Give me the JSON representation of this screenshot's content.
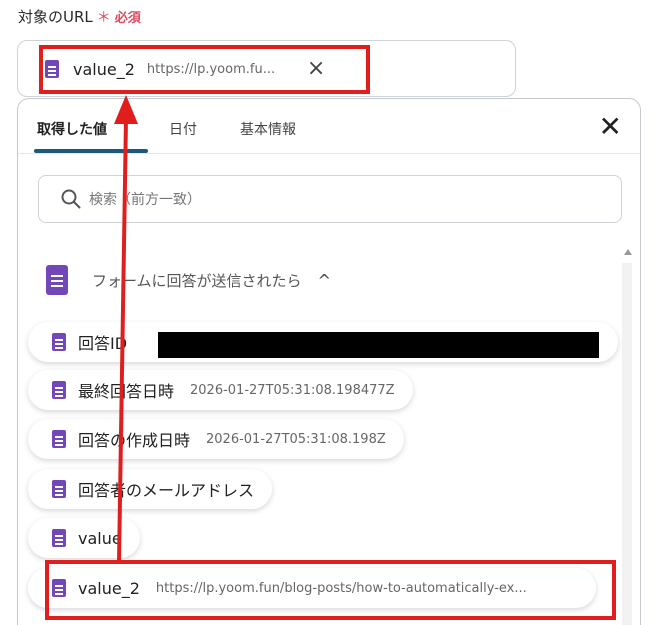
{
  "field": {
    "label": "対象のURL",
    "required_mark": "＊",
    "required_text": "必須",
    "selected": {
      "name": "value_2",
      "url": "https://lp.yoom.fu...",
      "close_icon": "×"
    }
  },
  "panel": {
    "tabs": [
      {
        "label": "取得した値"
      },
      {
        "label": "日付"
      },
      {
        "label": "基本情報"
      }
    ],
    "close_icon": "✕",
    "search_placeholder": "検索（前方一致）",
    "section": {
      "title": "フォームに回答が送信されたら",
      "chevron": "^"
    },
    "items": [
      {
        "label": "回答ID",
        "value": ""
      },
      {
        "label": "最終回答日時",
        "value": "2026-01-27T05:31:08.198477Z"
      },
      {
        "label": "回答の作成日時",
        "value": "2026-01-27T05:31:08.198Z"
      },
      {
        "label": "回答者のメールアドレス",
        "value": ""
      },
      {
        "label": "value",
        "value": ""
      },
      {
        "label": "value_2",
        "value": "https://lp.yoom.fun/blog-posts/how-to-automatically-ex..."
      }
    ]
  },
  "annotation_color": "#e11e1e"
}
